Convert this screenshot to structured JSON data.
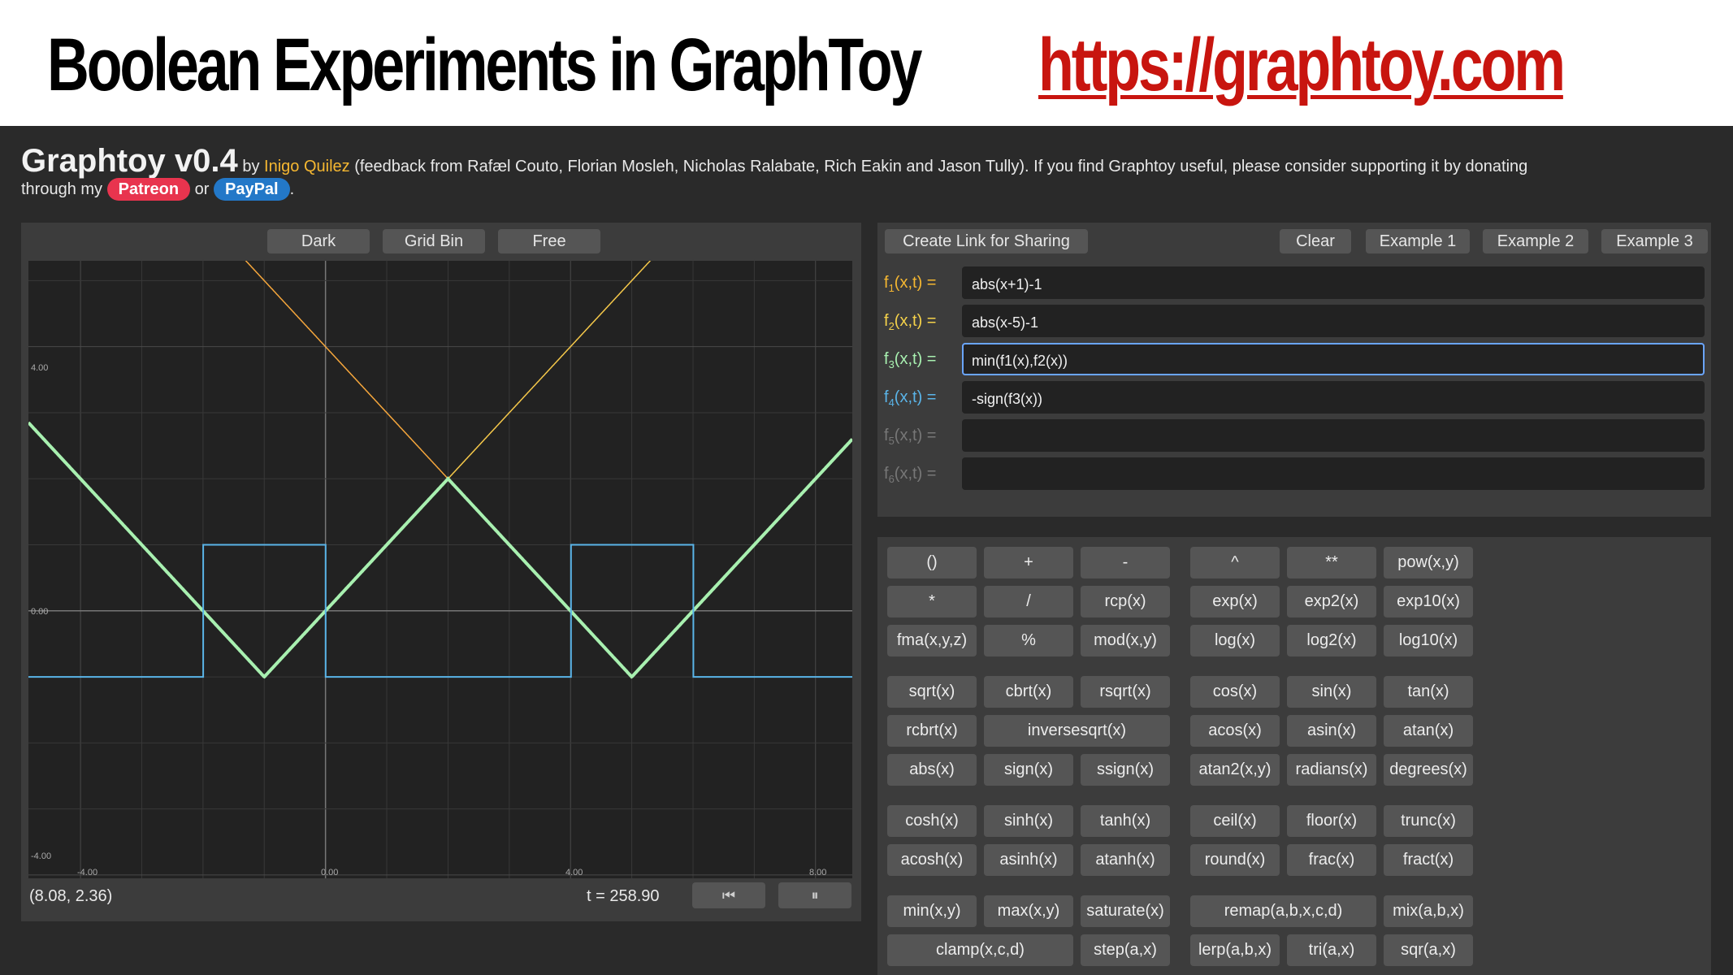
{
  "banner": {
    "title": "Boolean Experiments in GraphToy",
    "link": "https://graphtoy.com"
  },
  "header": {
    "app_name": "Graphtoy v0.4",
    "by": " by ",
    "author": "Inigo Quilez",
    "credits": " (feedback from Rafæl Couto, Florian Mosleh, Nicholas Ralabate, Rich Eakin and Jason Tully). If you find Graphtoy useful, please consider supporting it by donating",
    "through": "through my ",
    "patreon": "Patreon",
    "or": " or ",
    "paypal": "PayPal",
    "end": "."
  },
  "graph": {
    "buttons": {
      "dark": "Dark",
      "grid": "Grid Bin",
      "free": "Free"
    },
    "tick_labels": {
      "y_top": "4.00",
      "y_mid": "0.00",
      "y_bottom": "-4.00",
      "x_left": "-4.00",
      "x_zero": "0.00",
      "x_four": "4.00",
      "x_eight": "8.00"
    },
    "coord": "(8.08, 2.36)",
    "time": "t = 258.90",
    "rewind_icon": "⏮",
    "pause_icon": "⏸",
    "colors": {
      "f1": "#f5c84a",
      "f2": "#f5a63c",
      "f3": "#a8f0b0",
      "f4": "#5ab4e8"
    }
  },
  "formulas": {
    "share": "Create Link for Sharing",
    "clear": "Clear",
    "example1": "Example 1",
    "example2": "Example 2",
    "example3": "Example 3",
    "rows": [
      {
        "name": "f",
        "index": "1",
        "args": "(x,t) =",
        "value": "abs(x+1)-1",
        "color": "#f5b731"
      },
      {
        "name": "f",
        "index": "2",
        "args": "(x,t) =",
        "value": "abs(x-5)-1",
        "color": "#f5d24a"
      },
      {
        "name": "f",
        "index": "3",
        "args": "(x,t) =",
        "value": "min(f1(x),f2(x))",
        "color": "#a8f0b0"
      },
      {
        "name": "f",
        "index": "4",
        "args": "(x,t) =",
        "value": "-sign(f3(x))",
        "color": "#5ab4e8"
      },
      {
        "name": "f",
        "index": "5",
        "args": "(x,t) =",
        "value": "",
        "color": "#777777"
      },
      {
        "name": "f",
        "index": "6",
        "args": "(x,t) =",
        "value": "",
        "color": "#777777"
      }
    ]
  },
  "keypad": {
    "keys": [
      "()",
      "+",
      "-",
      "^",
      "**",
      "pow(x,y)",
      "*",
      "/",
      "rcp(x)",
      "exp(x)",
      "exp2(x)",
      "exp10(x)",
      "fma(x,y,z)",
      "%",
      "mod(x,y)",
      "log(x)",
      "log2(x)",
      "log10(x)",
      "sqrt(x)",
      "cbrt(x)",
      "rsqrt(x)",
      "cos(x)",
      "sin(x)",
      "tan(x)",
      "rcbrt(x)",
      "inversesqrt(x)",
      "acos(x)",
      "asin(x)",
      "atan(x)",
      "abs(x)",
      "sign(x)",
      "ssign(x)",
      "atan2(x,y)",
      "radians(x)",
      "degrees(x)",
      "cosh(x)",
      "sinh(x)",
      "tanh(x)",
      "ceil(x)",
      "floor(x)",
      "trunc(x)",
      "acosh(x)",
      "asinh(x)",
      "atanh(x)",
      "round(x)",
      "frac(x)",
      "fract(x)",
      "min(x,y)",
      "max(x,y)",
      "saturate(x)",
      "remap(a,b,x,c,d)",
      "mix(a,b,x)",
      "clamp(x,c,d)",
      "step(a,x)",
      "lerp(a,b,x)",
      "tri(a,x)",
      "sqr(a,x)"
    ]
  }
}
